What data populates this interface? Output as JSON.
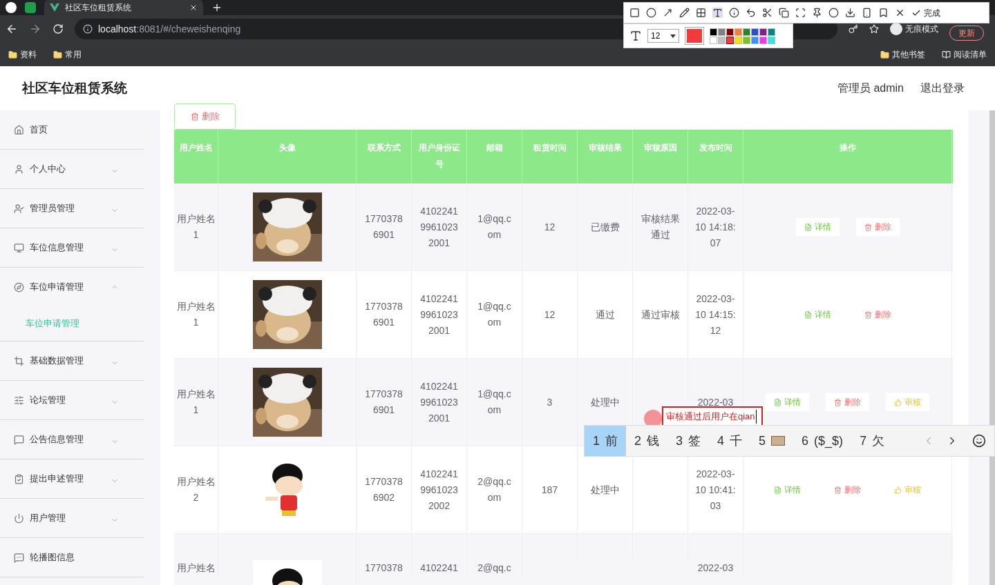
{
  "browser": {
    "tabs": [
      {
        "title": "社区车位租赁系统",
        "selected": true
      }
    ],
    "url_host": "localhost",
    "url_rest": ":8081/#/cheweishenqing",
    "bookmarks": [
      "资料",
      "常用"
    ],
    "bookmarks_right": [
      "其他书签",
      "阅读清单"
    ],
    "incognito": "无痕模式",
    "update": "更新"
  },
  "annotation_toolbar": {
    "done": "完成",
    "font_size": "12",
    "palette": [
      {
        "color": "#000000",
        "selected": false
      },
      {
        "color": "#808080",
        "selected": false
      },
      {
        "color": "#800000",
        "selected": false
      },
      {
        "color": "#f08040",
        "selected": false
      },
      {
        "color": "#308030",
        "selected": false
      },
      {
        "color": "#3050c0",
        "selected": false
      },
      {
        "color": "#802080",
        "selected": false
      },
      {
        "color": "#108080",
        "selected": false
      },
      {
        "color": "#ffffff",
        "selected": false
      },
      {
        "color": "#c0c0c0",
        "selected": false
      },
      {
        "color": "#f03c3c",
        "selected": true
      },
      {
        "color": "#f0e020",
        "selected": false
      },
      {
        "color": "#80c020",
        "selected": false
      },
      {
        "color": "#4090f0",
        "selected": false
      },
      {
        "color": "#e040e0",
        "selected": false
      },
      {
        "color": "#40e0e0",
        "selected": false
      }
    ]
  },
  "app": {
    "title": "社区车位租赁系统",
    "user": "管理员 admin",
    "logout": "退出登录"
  },
  "sidebar": {
    "items": [
      {
        "label": "首页",
        "kind": "link"
      },
      {
        "label": "个人中心",
        "kind": "menu",
        "expanded": false
      },
      {
        "label": "管理员管理",
        "kind": "menu",
        "expanded": false
      },
      {
        "label": "车位信息管理",
        "kind": "menu",
        "expanded": false
      },
      {
        "label": "车位申请管理",
        "kind": "menu",
        "expanded": true,
        "children": [
          {
            "label": "车位申请管理",
            "selected": true
          }
        ]
      },
      {
        "label": "基础数据管理",
        "kind": "menu",
        "expanded": false
      },
      {
        "label": "论坛管理",
        "kind": "menu",
        "expanded": false
      },
      {
        "label": "公告信息管理",
        "kind": "menu",
        "expanded": false
      },
      {
        "label": "提出申述管理",
        "kind": "menu",
        "expanded": false
      },
      {
        "label": "用户管理",
        "kind": "menu",
        "expanded": false
      },
      {
        "label": "轮播图信息",
        "kind": "link"
      }
    ]
  },
  "toolbar": {
    "delete": "删除"
  },
  "table": {
    "columns": [
      "用户姓名",
      "头像",
      "联系方式",
      "用户身份证号",
      "邮箱",
      "租赁时间",
      "审核结果",
      "审核原因",
      "发布时间",
      "操作"
    ],
    "rows": [
      {
        "name": "用户姓名1",
        "phone": "17703786901",
        "id_number": "410224199610232001",
        "email": "1@qq.com",
        "rent_time": "12",
        "result": "已缴费",
        "reason": "审核结果通过",
        "published": "2022-03-10 14:18:07",
        "actions": [
          {
            "label": "详情",
            "kind": "detail"
          },
          {
            "label": "删除",
            "kind": "delete"
          }
        ]
      },
      {
        "name": "用户姓名1",
        "phone": "17703786901",
        "id_number": "410224199610232001",
        "email": "1@qq.com",
        "rent_time": "12",
        "result": "通过",
        "reason": "通过审核",
        "published": "2022-03-10 14:15:12",
        "actions": [
          {
            "label": "详情",
            "kind": "detail"
          },
          {
            "label": "删除",
            "kind": "delete"
          }
        ]
      },
      {
        "name": "用户姓名1",
        "phone": "17703786901",
        "id_number": "410224199610232001",
        "email": "1@qq.com",
        "rent_time": "3",
        "result": "处理中",
        "published": "2022-03",
        "actions": [
          {
            "label": "详情",
            "kind": "detail"
          },
          {
            "label": "删除",
            "kind": "delete"
          },
          {
            "label": "审核",
            "kind": "review"
          }
        ]
      },
      {
        "name": "用户姓名2",
        "phone": "17703786902",
        "id_number": "410224199610232002",
        "email": "2@qq.com",
        "rent_time": "187",
        "result": "处理中",
        "published": "2022-03-10 10:41:03",
        "actions": [
          {
            "label": "详情",
            "kind": "detail"
          },
          {
            "label": "删除",
            "kind": "delete"
          },
          {
            "label": "审核",
            "kind": "review"
          }
        ]
      },
      {
        "name": "用户姓名",
        "phone": "1770378",
        "id_number": "4102241",
        "email": "2@qq.c",
        "published": "2022-03",
        "actions": []
      }
    ]
  },
  "annotation_text": "审核通过后用户在qian",
  "ime": {
    "candidates": [
      {
        "number": "1",
        "text": "前",
        "kind": "text",
        "selected": true
      },
      {
        "number": "2",
        "text": "钱",
        "kind": "text",
        "selected": false
      },
      {
        "number": "3",
        "text": "签",
        "kind": "text",
        "selected": false
      },
      {
        "number": "4",
        "text": "千",
        "kind": "text",
        "selected": false
      },
      {
        "number": "5",
        "kind": "picture",
        "selected": false
      },
      {
        "number": "6",
        "text": "($_$)",
        "kind": "text",
        "selected": false
      },
      {
        "number": "7",
        "text": "欠",
        "kind": "text",
        "selected": false
      }
    ]
  }
}
